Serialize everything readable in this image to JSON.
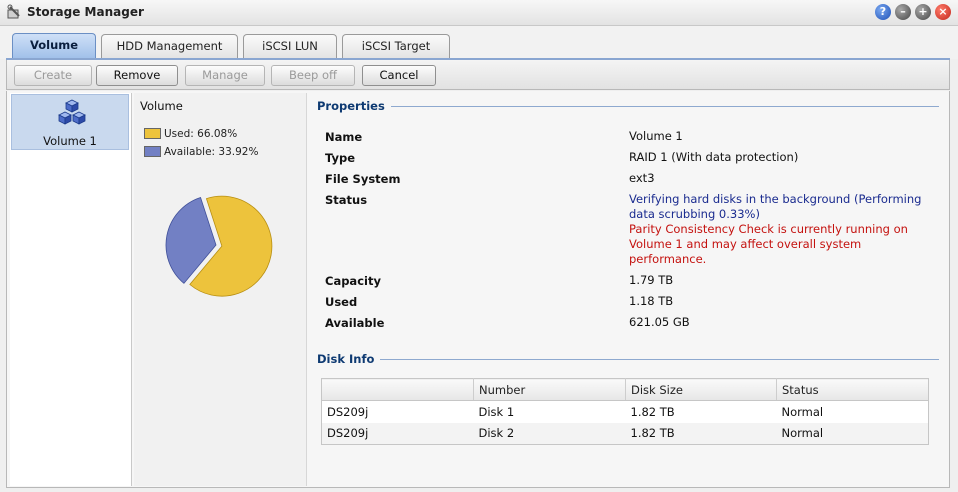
{
  "window": {
    "title": "Storage Manager",
    "buttons": {
      "help": "?",
      "minimize": "–",
      "maximize": "+",
      "close": "×"
    }
  },
  "tabs": [
    {
      "label": "Volume",
      "active": true
    },
    {
      "label": "HDD Management",
      "active": false
    },
    {
      "label": "iSCSI LUN",
      "active": false
    },
    {
      "label": "iSCSI Target",
      "active": false
    }
  ],
  "toolbar": {
    "create": "Create",
    "remove": "Remove",
    "manage": "Manage",
    "beep_off": "Beep off",
    "cancel": "Cancel"
  },
  "volume_list": [
    {
      "label": "Volume 1",
      "icon": "cubes-icon",
      "selected": true
    }
  ],
  "usage": {
    "title": "Volume",
    "used_label": "Used: 66.08%",
    "available_label": "Available: 33.92%",
    "used_fraction": 0.6608,
    "available_fraction": 0.3392,
    "colors": {
      "used": "#edc33c",
      "available": "#7280c4"
    }
  },
  "properties": {
    "heading": "Properties",
    "rows": [
      {
        "label": "Name",
        "value": "Volume 1"
      },
      {
        "label": "Type",
        "value": "RAID 1 (With data protection)"
      },
      {
        "label": "File System",
        "value": "ext3"
      },
      {
        "label": "Status",
        "value_blue_1": "Verifying hard disks in the background (Performing",
        "value_blue_2": "data scrubbing 0.33%)",
        "value_red_1": "Parity Consistency Check is currently running on",
        "value_red_2": "Volume 1 and may affect overall system",
        "value_red_3": "performance."
      },
      {
        "label": "Capacity",
        "value": "1.79 TB"
      },
      {
        "label": "Used",
        "value": "1.18 TB"
      },
      {
        "label": "Available",
        "value": "621.05 GB"
      }
    ]
  },
  "disk_info": {
    "heading": "Disk Info",
    "columns": [
      "",
      "Number",
      "Disk Size",
      "Status"
    ],
    "rows": [
      [
        "DS209j",
        "Disk 1",
        "1.82 TB",
        "Normal"
      ],
      [
        "DS209j",
        "Disk 2",
        "1.82 TB",
        "Normal"
      ]
    ]
  }
}
